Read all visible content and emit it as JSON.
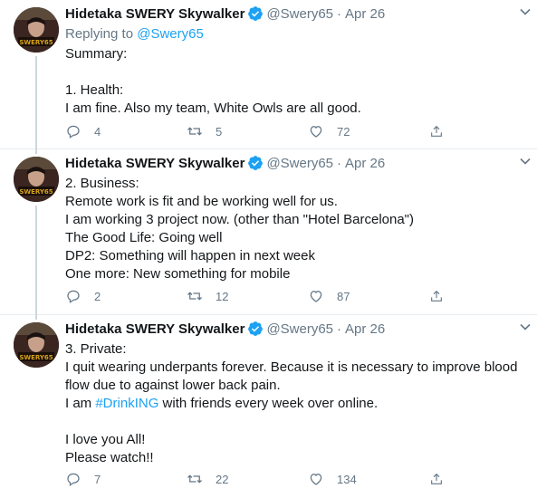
{
  "tweets": [
    {
      "author_name": "Hidetaka SWERY Skywalker",
      "handle": "@Swery65",
      "date": "Apr 26",
      "reply_prefix": "Replying to ",
      "reply_to": "@Swery65",
      "text": "Summary:\n\n1. Health:\nI am fine. Also my team, White Owls are all good.",
      "replies": "4",
      "retweets": "5",
      "likes": "72"
    },
    {
      "author_name": "Hidetaka SWERY Skywalker",
      "handle": "@Swery65",
      "date": "Apr 26",
      "text": "2. Business:\nRemote work is fit and be working well for us.\nI am working 3 project now. (other than \"Hotel Barcelona\")\nThe Good Life: Going well\nDP2: Something will happen in next week\nOne more: New something for mobile",
      "replies": "2",
      "retweets": "12",
      "likes": "87"
    },
    {
      "author_name": "Hidetaka SWERY Skywalker",
      "handle": "@Swery65",
      "date": "Apr 26",
      "text_before_hashtag": "3. Private:\nI quit wearing underpants forever. Because it is necessary to improve blood flow due to against lower back pain.\nI am ",
      "hashtag": "#DrinkING",
      "text_after_hashtag": " with friends every week over online.\n\nI love you All!\nPlease watch!!",
      "replies": "7",
      "retweets": "22",
      "likes": "134"
    }
  ],
  "dot": "·",
  "colors": {
    "accent": "#1da1f2",
    "secondary": "#657786",
    "border": "#e6ecf0",
    "avatar_text": "#d9a21b"
  },
  "avatar_text": "SWERY65"
}
